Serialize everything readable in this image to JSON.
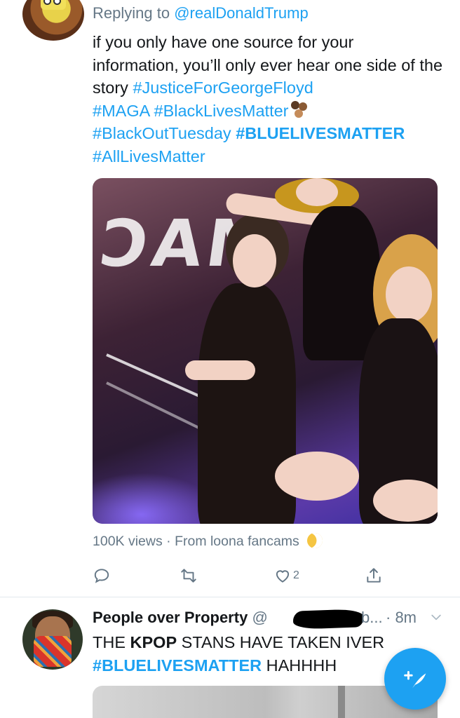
{
  "tweet1": {
    "replying_prefix": "Replying to",
    "replying_handle": "@realDonaldTrump",
    "text_plain": "if you only have one source for your information, you’ll only ever hear one side of the story",
    "hashtags": [
      "#JusticeForGeorgeFloyd",
      "#MAGA",
      "#BlackLivesMatter",
      "#BlackOutTuesday",
      "#BLUELIVESMATTER",
      "#AllLivesMatter"
    ],
    "emoji_after_blacklivesmatter": "raised-fists-emoji",
    "media": {
      "overlay_letters": "ƆAM"
    },
    "media_caption": {
      "views": "100K views",
      "separator": "·",
      "source": "From loona fancams",
      "emoji": "crescent-moon-emoji"
    },
    "actions": {
      "reply_icon": "reply-icon",
      "retweet_icon": "retweet-icon",
      "like_icon": "heart-icon",
      "like_count": "2",
      "share_icon": "share-icon"
    }
  },
  "tweet2": {
    "author_name": "People over Property",
    "handle_start": "@",
    "handle_tail": "b...",
    "time": "· 8m",
    "menu_icon": "chevron-down-icon",
    "text_prefix": "THE",
    "text_bold": "KPOP",
    "text_rest": "STANS HAVE TAKEN IVER",
    "text_hashtag": "#BLUELIVESMATTER",
    "text_tail": "HAHHHH"
  },
  "compose_button": {
    "icon": "compose-feather-icon"
  },
  "colors": {
    "accent": "#1da1f2",
    "text": "#14171a",
    "secondary_text": "#657786",
    "divider": "#e1e8ed"
  }
}
